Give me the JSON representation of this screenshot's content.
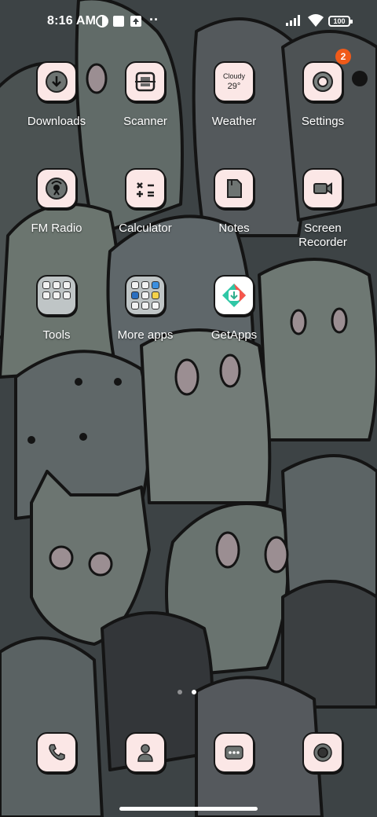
{
  "status_bar": {
    "time": "8:16 AM",
    "battery": "100",
    "overflow": "··",
    "icons": [
      "notification-icon",
      "gallery-icon",
      "upload-icon",
      "signal-icon",
      "wifi-icon",
      "battery-icon"
    ]
  },
  "apps": [
    {
      "label": "Downloads",
      "icon": "download-icon"
    },
    {
      "label": "Scanner",
      "icon": "scanner-icon"
    },
    {
      "label": "Weather",
      "icon": "weather-widget",
      "condition": "Cloudy",
      "temp": "29°"
    },
    {
      "label": "Settings",
      "icon": "gear-icon",
      "badge": "2"
    },
    {
      "label": "FM Radio",
      "icon": "radio-icon"
    },
    {
      "label": "Calculator",
      "icon": "calculator-icon"
    },
    {
      "label": "Notes",
      "icon": "notes-icon"
    },
    {
      "label": "Screen\nRecorder",
      "icon": "video-camera-icon"
    },
    {
      "label": "Tools",
      "icon": "folder-icon"
    },
    {
      "label": "More apps",
      "icon": "folder-icon"
    },
    {
      "label": "GetApps",
      "icon": "getapps-icon"
    }
  ],
  "dock": [
    {
      "icon": "phone-icon"
    },
    {
      "icon": "contacts-icon"
    },
    {
      "icon": "messages-icon"
    },
    {
      "icon": "camera-icon"
    }
  ],
  "page_indicator": {
    "pages": 2,
    "current": 2
  },
  "colors": {
    "icon_bg": "#fbe7e6",
    "outline": "#161616",
    "badge": "#f05a19",
    "wallpaper_base": "#3e4446"
  }
}
